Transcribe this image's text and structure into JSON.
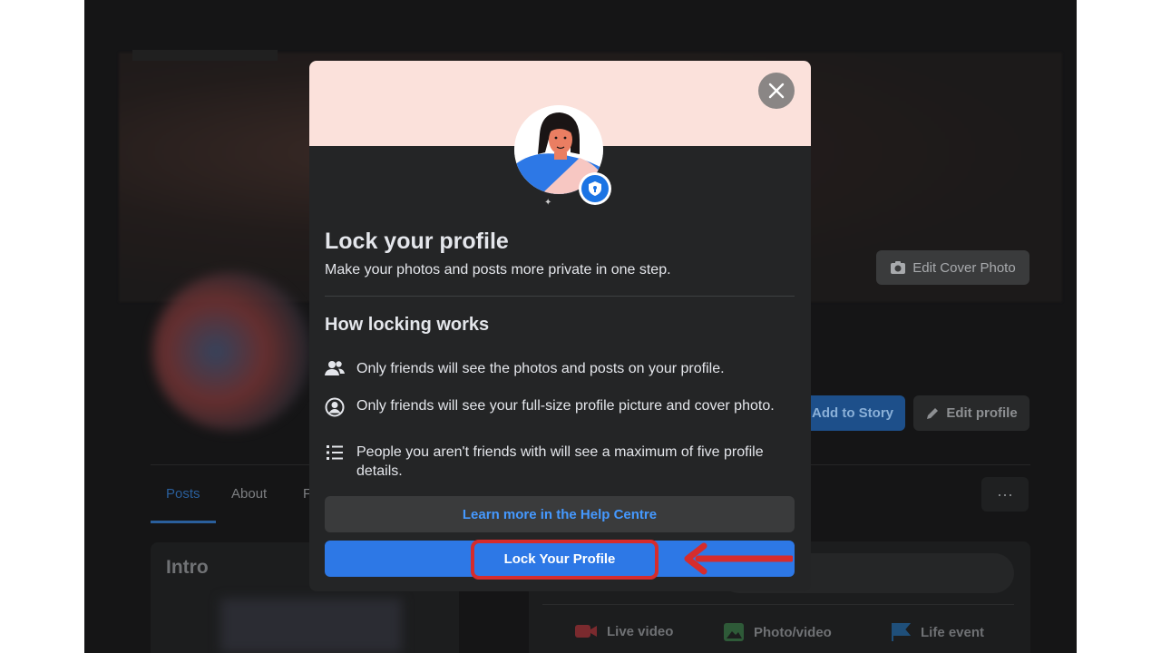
{
  "background": {
    "edit_cover_label": "Edit Cover Photo",
    "add_to_story_label": "Add to Story",
    "edit_profile_label": "Edit profile",
    "more_label": "···",
    "tabs": [
      {
        "label": "Posts"
      },
      {
        "label": "About"
      },
      {
        "label": "F"
      }
    ],
    "intro_title": "Intro",
    "composer_actions": [
      {
        "label": "Live video",
        "icon": "live-video-icon",
        "color": "#7a2a2e"
      },
      {
        "label": "Photo/video",
        "icon": "photo-icon",
        "color": "#2e5a38"
      },
      {
        "label": "Life event",
        "icon": "flag-icon",
        "color": "#1f4f7a"
      }
    ]
  },
  "modal": {
    "close_icon": "close-icon",
    "badge_icon": "shield-lock-icon",
    "title": "Lock your profile",
    "subtitle": "Make your photos and posts more private in one step.",
    "section_title": "How locking works",
    "bullets": [
      {
        "icon": "friends-icon",
        "text": "Only friends will see the photos and posts on your profile."
      },
      {
        "icon": "profile-circle-icon",
        "text": "Only friends will see your full-size profile picture and cover photo."
      },
      {
        "icon": "list-icon",
        "text": "People you aren't friends with will see a maximum of five profile details."
      }
    ],
    "learn_more_label": "Learn more in the Help Centre",
    "lock_button_label": "Lock Your Profile"
  },
  "colors": {
    "primary": "#2d78e6",
    "link": "#4599ff",
    "annotation": "#d62c2c",
    "band": "#fbe1db"
  }
}
